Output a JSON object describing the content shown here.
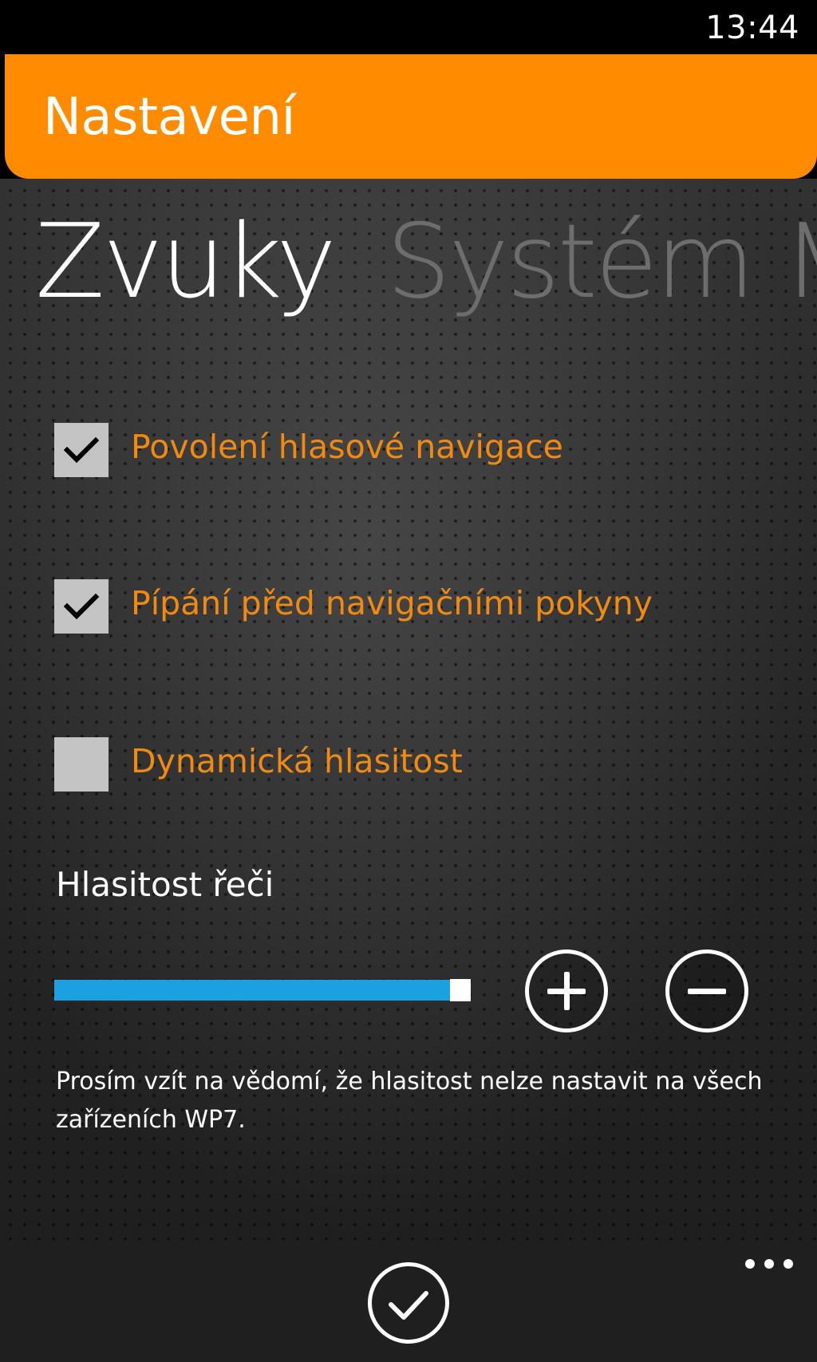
{
  "status_bar": {
    "time": "13:44"
  },
  "header": {
    "title": "Nastavení"
  },
  "pivot": {
    "active": "Zvuky",
    "next": "Systém M"
  },
  "settings": {
    "voice_navigation": {
      "label": "Povolení hlasové navigace",
      "checked": true
    },
    "beep_before": {
      "label": "Pípání před navigačními pokyny",
      "checked": true
    },
    "dynamic_volume": {
      "label": "Dynamická hlasitost",
      "checked": false
    }
  },
  "speech_volume": {
    "title": "Hlasitost řeči",
    "level": 1.0
  },
  "note": "Prosím vzít na vědomí, že hlasitost nelze nastavit na všech zařízeních WP7.",
  "icons": {
    "check": "check-icon",
    "plus": "plus-circle-icon",
    "minus": "minus-circle-icon",
    "confirm": "check-circle-icon",
    "more": "more-dots-icon"
  },
  "colors": {
    "accent": "#ff8c00",
    "label": "#f08a10",
    "slider": "#1ba1e2"
  }
}
